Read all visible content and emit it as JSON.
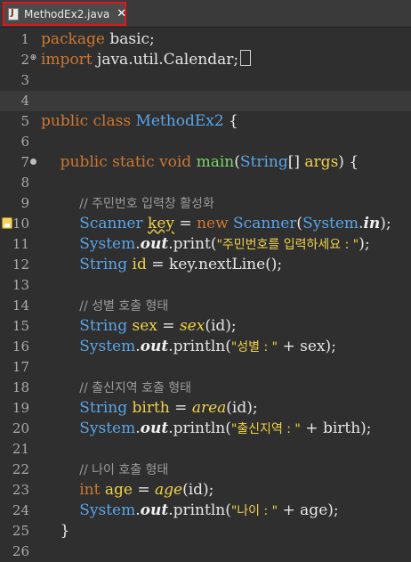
{
  "tab": {
    "title": "MethodEx2.java",
    "close_glyph": "✕",
    "highlight_color": "#e0141d"
  },
  "lines": [
    {
      "n": "1",
      "tokens": [
        {
          "t": "package",
          "c": "kw"
        },
        {
          "t": " basic;",
          "c": "pl"
        }
      ]
    },
    {
      "n": "2",
      "marker": "plus",
      "tokens": [
        {
          "t": "import",
          "c": "kw"
        },
        {
          "t": " java.util.Calendar;",
          "c": "pl"
        }
      ],
      "box": true
    },
    {
      "n": "3",
      "tokens": []
    },
    {
      "n": "4",
      "current": true,
      "tokens": []
    },
    {
      "n": "5",
      "tokens": [
        {
          "t": "public class ",
          "c": "kw"
        },
        {
          "t": "MethodEx2",
          "c": "ty"
        },
        {
          "t": " {",
          "c": "pl"
        }
      ]
    },
    {
      "n": "6",
      "tokens": []
    },
    {
      "n": "7",
      "marker": "dot",
      "tokens": [
        {
          "t": "    public static void ",
          "c": "kw"
        },
        {
          "t": "main",
          "c": "fn"
        },
        {
          "t": "(",
          "c": "pl"
        },
        {
          "t": "String",
          "c": "ty"
        },
        {
          "t": "[] ",
          "c": "pl"
        },
        {
          "t": "args",
          "c": "var"
        },
        {
          "t": ") {",
          "c": "pl"
        }
      ]
    },
    {
      "n": "8",
      "tokens": []
    },
    {
      "n": "9",
      "tokens": [
        {
          "t": "        ",
          "c": "pl"
        },
        {
          "t": "// 주민번호 입력창 활성화",
          "c": "cm"
        }
      ]
    },
    {
      "n": "10",
      "bookmark": true,
      "tokens": [
        {
          "t": "        ",
          "c": "pl"
        },
        {
          "t": "Scanner",
          "c": "ty"
        },
        {
          "t": " ",
          "c": "pl"
        },
        {
          "t": "key",
          "c": "var uw"
        },
        {
          "t": " = ",
          "c": "pl"
        },
        {
          "t": "new ",
          "c": "kw"
        },
        {
          "t": "Scanner",
          "c": "ty"
        },
        {
          "t": "(",
          "c": "pl"
        },
        {
          "t": "System",
          "c": "ty"
        },
        {
          "t": ".",
          "c": "pl"
        },
        {
          "t": "in",
          "c": "bi"
        },
        {
          "t": ");",
          "c": "pl"
        }
      ]
    },
    {
      "n": "11",
      "tokens": [
        {
          "t": "        ",
          "c": "pl"
        },
        {
          "t": "System",
          "c": "ty"
        },
        {
          "t": ".",
          "c": "pl"
        },
        {
          "t": "out",
          "c": "bi"
        },
        {
          "t": ".print(",
          "c": "pl"
        },
        {
          "t": "\"주민번호를 입력하세요 : \"",
          "c": "str"
        },
        {
          "t": ");",
          "c": "pl"
        }
      ]
    },
    {
      "n": "12",
      "tokens": [
        {
          "t": "        ",
          "c": "pl"
        },
        {
          "t": "String",
          "c": "ty"
        },
        {
          "t": " ",
          "c": "pl"
        },
        {
          "t": "id",
          "c": "var"
        },
        {
          "t": " = key.nextLine();",
          "c": "pl"
        }
      ]
    },
    {
      "n": "13",
      "tokens": []
    },
    {
      "n": "14",
      "tokens": [
        {
          "t": "        ",
          "c": "pl"
        },
        {
          "t": "// 성별 호출 형태",
          "c": "cm"
        }
      ]
    },
    {
      "n": "15",
      "tokens": [
        {
          "t": "        ",
          "c": "pl"
        },
        {
          "t": "String",
          "c": "ty"
        },
        {
          "t": " ",
          "c": "pl"
        },
        {
          "t": "sex",
          "c": "var"
        },
        {
          "t": " = ",
          "c": "pl"
        },
        {
          "t": "sex",
          "c": "var it"
        },
        {
          "t": "(id);",
          "c": "pl"
        }
      ]
    },
    {
      "n": "16",
      "tokens": [
        {
          "t": "        ",
          "c": "pl"
        },
        {
          "t": "System",
          "c": "ty"
        },
        {
          "t": ".",
          "c": "pl"
        },
        {
          "t": "out",
          "c": "bi"
        },
        {
          "t": ".println(",
          "c": "pl"
        },
        {
          "t": "\"성별 : \"",
          "c": "str"
        },
        {
          "t": " + sex);",
          "c": "pl"
        }
      ]
    },
    {
      "n": "17",
      "tokens": []
    },
    {
      "n": "18",
      "tokens": [
        {
          "t": "        ",
          "c": "pl"
        },
        {
          "t": "// 출신지역 호출 형태",
          "c": "cm"
        }
      ]
    },
    {
      "n": "19",
      "tokens": [
        {
          "t": "        ",
          "c": "pl"
        },
        {
          "t": "String",
          "c": "ty"
        },
        {
          "t": " ",
          "c": "pl"
        },
        {
          "t": "birth",
          "c": "var"
        },
        {
          "t": " = ",
          "c": "pl"
        },
        {
          "t": "area",
          "c": "var it"
        },
        {
          "t": "(id);",
          "c": "pl"
        }
      ]
    },
    {
      "n": "20",
      "tokens": [
        {
          "t": "        ",
          "c": "pl"
        },
        {
          "t": "System",
          "c": "ty"
        },
        {
          "t": ".",
          "c": "pl"
        },
        {
          "t": "out",
          "c": "bi"
        },
        {
          "t": ".println(",
          "c": "pl"
        },
        {
          "t": "\"출신지역 : \"",
          "c": "str"
        },
        {
          "t": " + birth);",
          "c": "pl"
        }
      ]
    },
    {
      "n": "21",
      "tokens": []
    },
    {
      "n": "22",
      "tokens": [
        {
          "t": "        ",
          "c": "pl"
        },
        {
          "t": "// 나이 호출 형태",
          "c": "cm"
        }
      ]
    },
    {
      "n": "23",
      "tokens": [
        {
          "t": "        ",
          "c": "pl"
        },
        {
          "t": "int",
          "c": "kw"
        },
        {
          "t": " ",
          "c": "pl"
        },
        {
          "t": "age",
          "c": "var"
        },
        {
          "t": " = ",
          "c": "pl"
        },
        {
          "t": "age",
          "c": "var it"
        },
        {
          "t": "(id);",
          "c": "pl"
        }
      ]
    },
    {
      "n": "24",
      "tokens": [
        {
          "t": "        ",
          "c": "pl"
        },
        {
          "t": "System",
          "c": "ty"
        },
        {
          "t": ".",
          "c": "pl"
        },
        {
          "t": "out",
          "c": "bi"
        },
        {
          "t": ".println(",
          "c": "pl"
        },
        {
          "t": "\"나이 : \"",
          "c": "str"
        },
        {
          "t": " + age);",
          "c": "pl"
        }
      ]
    },
    {
      "n": "25",
      "tokens": [
        {
          "t": "    }",
          "c": "pl"
        }
      ]
    },
    {
      "n": "26",
      "tokens": []
    }
  ]
}
